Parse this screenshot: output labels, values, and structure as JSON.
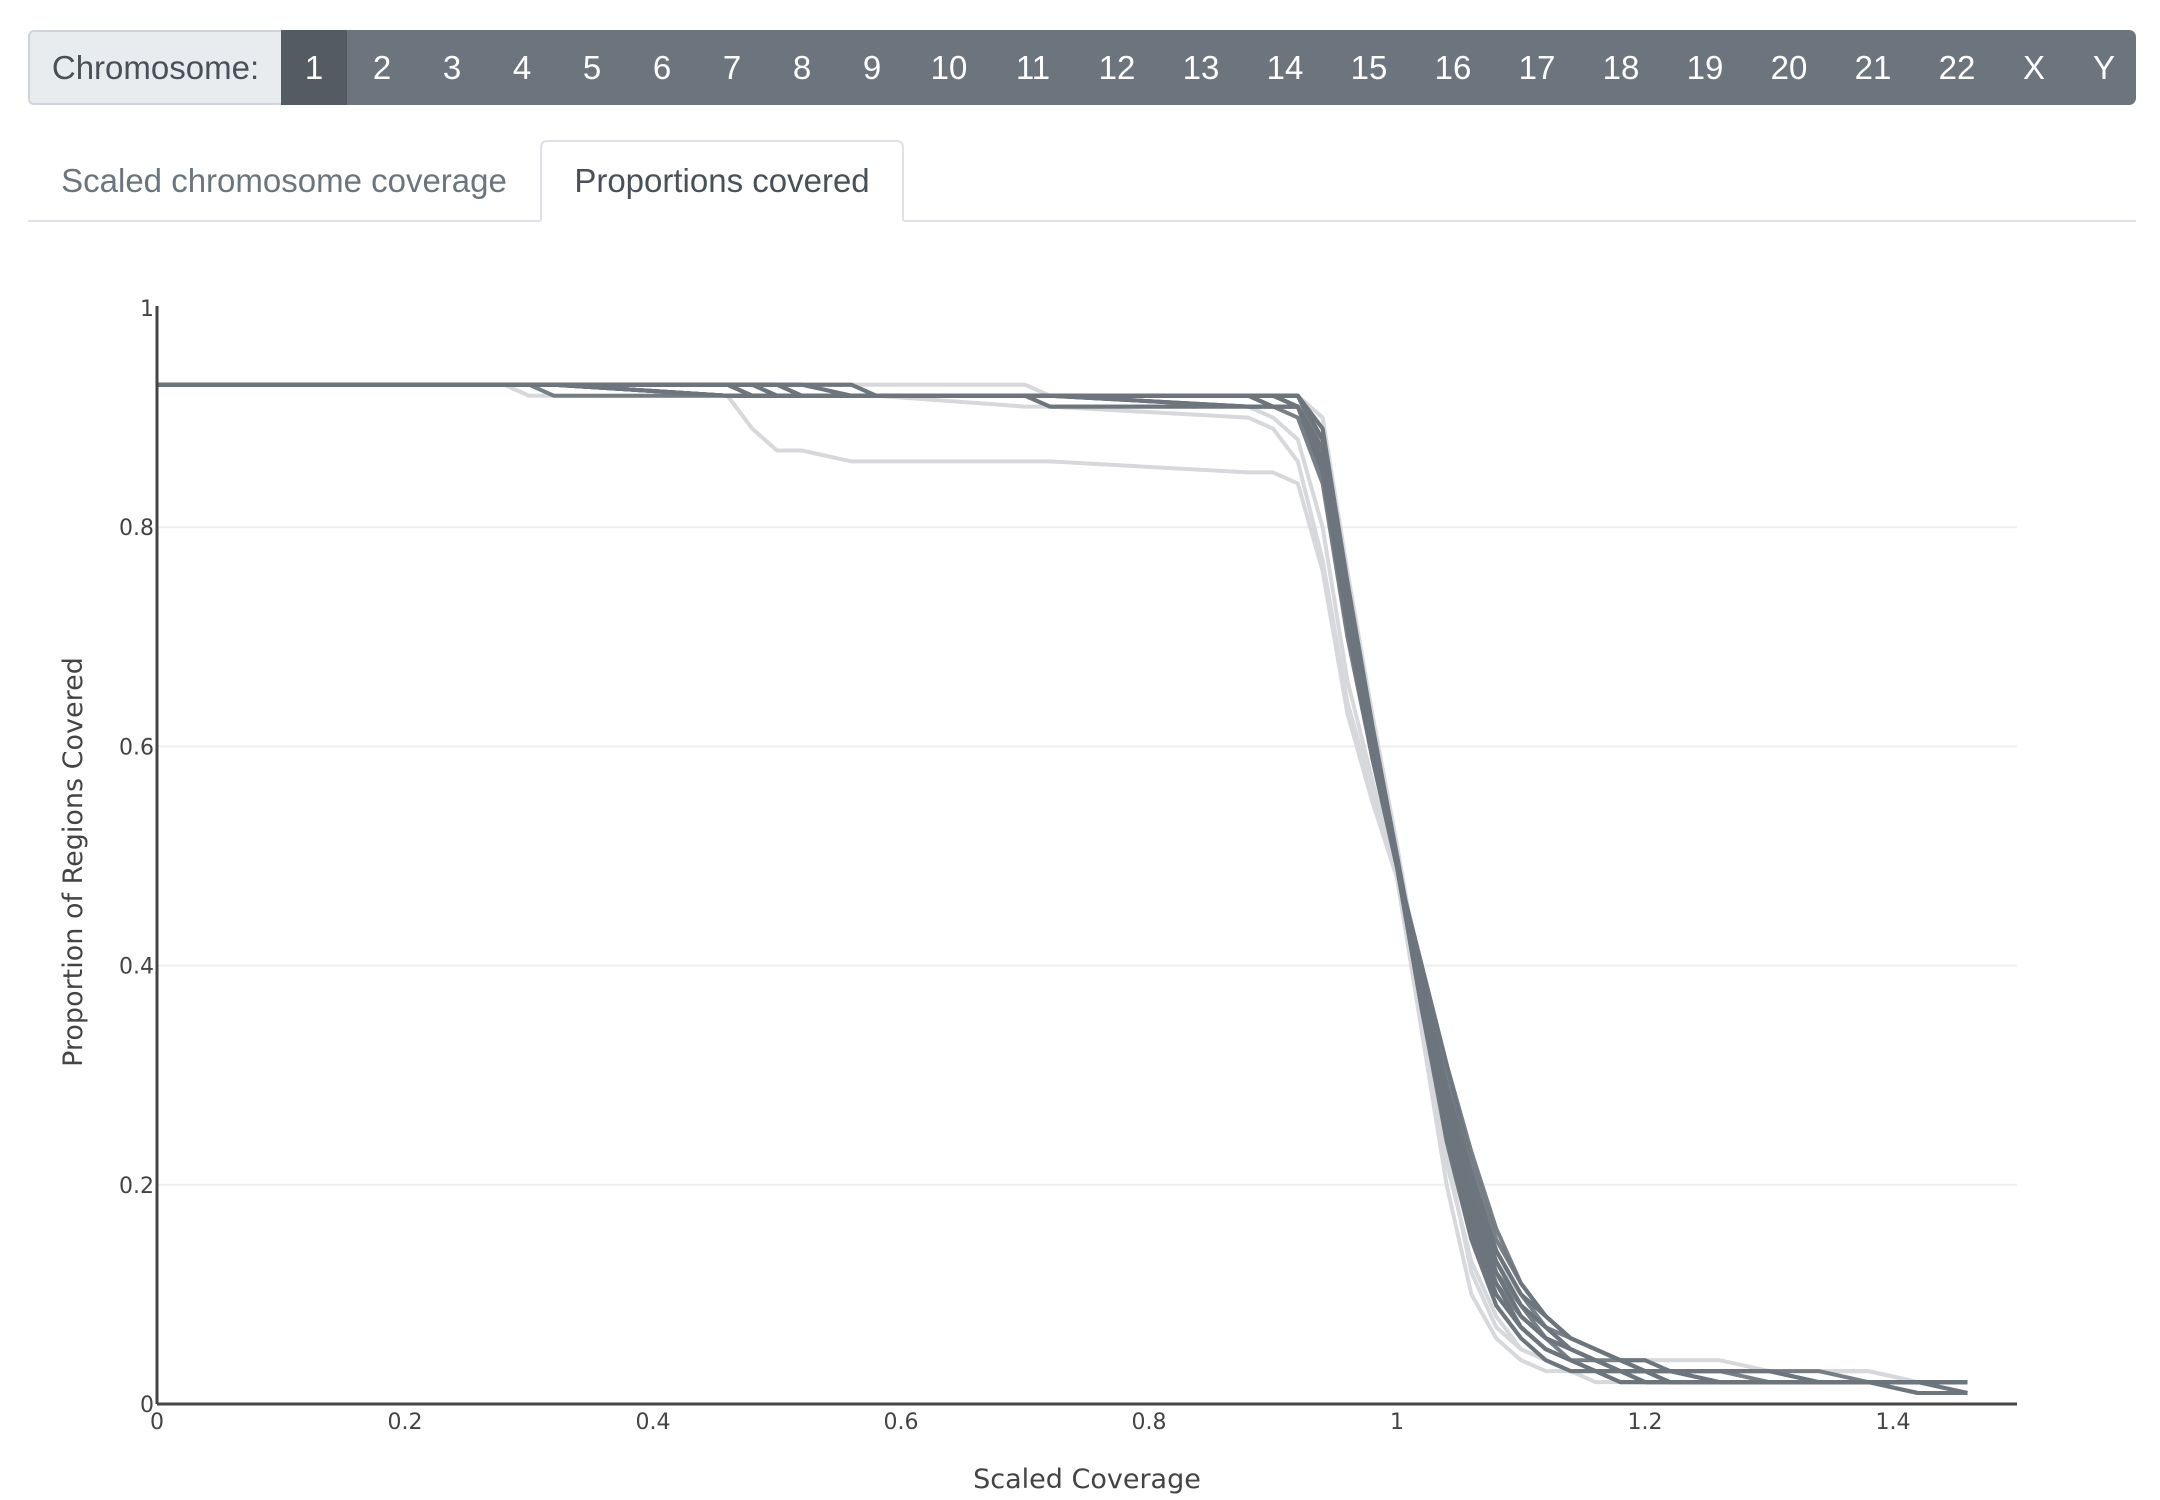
{
  "selector": {
    "label": "Chromosome:",
    "chromosomes": [
      "1",
      "2",
      "3",
      "4",
      "5",
      "6",
      "7",
      "8",
      "9",
      "10",
      "11",
      "12",
      "13",
      "14",
      "15",
      "16",
      "17",
      "18",
      "19",
      "20",
      "21",
      "22",
      "X",
      "Y"
    ],
    "active": "1",
    "bar_color": "#6c757d",
    "active_color": "#545b62"
  },
  "tabs": [
    {
      "label": "Scaled chromosome coverage",
      "active": false
    },
    {
      "label": "Proportions covered",
      "active": true
    }
  ],
  "chart_data": {
    "type": "line",
    "title": "",
    "xlabel": "Scaled Coverage",
    "ylabel": "Proportion of Regions Covered",
    "xlim": [
      0,
      1.5
    ],
    "ylim": [
      0,
      1
    ],
    "xticks": [
      0,
      0.2,
      0.4,
      0.6,
      0.8,
      1,
      1.2,
      1.4
    ],
    "xtick_labels": [
      "0",
      "0.2",
      "0.4",
      "0.6",
      "0.8",
      "1",
      "1.2",
      "1.4"
    ],
    "yticks": [
      0,
      0.2,
      0.4,
      0.6,
      0.8,
      1
    ],
    "ytick_labels": [
      "0",
      "0.2",
      "0.4",
      "0.6",
      "0.8",
      "1"
    ],
    "grid": "horizontal",
    "legend": "none",
    "line_color": "#6c757d",
    "faint_line_color": "#d6d8db",
    "x": [
      0,
      0.28,
      0.3,
      0.32,
      0.46,
      0.48,
      0.5,
      0.52,
      0.56,
      0.58,
      0.7,
      0.72,
      0.88,
      0.9,
      0.92,
      0.94,
      0.96,
      0.98,
      1.0,
      1.02,
      1.04,
      1.06,
      1.08,
      1.1,
      1.12,
      1.14,
      1.16,
      1.18,
      1.2,
      1.22,
      1.26,
      1.3,
      1.34,
      1.38,
      1.42,
      1.46
    ],
    "series": [
      {
        "name": "series-1",
        "opacity": 1.0,
        "values": [
          0.93,
          0.93,
          0.93,
          0.93,
          0.93,
          0.93,
          0.93,
          0.93,
          0.92,
          0.92,
          0.92,
          0.92,
          0.92,
          0.92,
          0.92,
          0.88,
          0.74,
          0.61,
          0.49,
          0.36,
          0.25,
          0.17,
          0.11,
          0.08,
          0.06,
          0.05,
          0.04,
          0.03,
          0.03,
          0.02,
          0.02,
          0.02,
          0.02,
          0.02,
          0.02,
          0.02
        ]
      },
      {
        "name": "series-2",
        "opacity": 1.0,
        "values": [
          0.93,
          0.93,
          0.93,
          0.93,
          0.93,
          0.92,
          0.92,
          0.92,
          0.92,
          0.92,
          0.92,
          0.92,
          0.92,
          0.92,
          0.91,
          0.86,
          0.72,
          0.6,
          0.49,
          0.37,
          0.26,
          0.17,
          0.11,
          0.07,
          0.05,
          0.04,
          0.03,
          0.03,
          0.02,
          0.02,
          0.02,
          0.02,
          0.02,
          0.02,
          0.01,
          0.01
        ]
      },
      {
        "name": "series-3",
        "opacity": 1.0,
        "values": [
          0.93,
          0.93,
          0.93,
          0.93,
          0.92,
          0.92,
          0.92,
          0.92,
          0.92,
          0.92,
          0.92,
          0.91,
          0.91,
          0.91,
          0.91,
          0.87,
          0.73,
          0.61,
          0.5,
          0.38,
          0.28,
          0.19,
          0.13,
          0.09,
          0.07,
          0.05,
          0.04,
          0.03,
          0.03,
          0.03,
          0.02,
          0.02,
          0.02,
          0.02,
          0.02,
          0.02
        ]
      },
      {
        "name": "series-4",
        "opacity": 1.0,
        "values": [
          0.93,
          0.93,
          0.93,
          0.92,
          0.92,
          0.92,
          0.92,
          0.92,
          0.92,
          0.92,
          0.92,
          0.92,
          0.91,
          0.91,
          0.91,
          0.85,
          0.71,
          0.59,
          0.49,
          0.39,
          0.29,
          0.21,
          0.14,
          0.1,
          0.08,
          0.06,
          0.05,
          0.04,
          0.03,
          0.03,
          0.03,
          0.03,
          0.02,
          0.02,
          0.02,
          0.02
        ]
      },
      {
        "name": "series-5",
        "opacity": 1.0,
        "values": [
          0.93,
          0.93,
          0.93,
          0.93,
          0.93,
          0.93,
          0.93,
          0.92,
          0.92,
          0.92,
          0.92,
          0.92,
          0.92,
          0.92,
          0.92,
          0.89,
          0.75,
          0.62,
          0.5,
          0.37,
          0.24,
          0.15,
          0.09,
          0.06,
          0.04,
          0.03,
          0.03,
          0.02,
          0.02,
          0.02,
          0.02,
          0.02,
          0.02,
          0.02,
          0.02,
          0.02
        ]
      },
      {
        "name": "series-6",
        "opacity": 1.0,
        "values": [
          0.93,
          0.93,
          0.93,
          0.93,
          0.92,
          0.92,
          0.92,
          0.92,
          0.92,
          0.92,
          0.92,
          0.92,
          0.92,
          0.91,
          0.9,
          0.84,
          0.7,
          0.59,
          0.49,
          0.4,
          0.31,
          0.22,
          0.15,
          0.11,
          0.08,
          0.06,
          0.05,
          0.04,
          0.04,
          0.03,
          0.03,
          0.03,
          0.02,
          0.02,
          0.02,
          0.02
        ]
      },
      {
        "name": "series-7",
        "opacity": 1.0,
        "values": [
          0.93,
          0.93,
          0.93,
          0.93,
          0.93,
          0.92,
          0.92,
          0.92,
          0.92,
          0.92,
          0.92,
          0.92,
          0.92,
          0.92,
          0.91,
          0.87,
          0.73,
          0.6,
          0.49,
          0.37,
          0.27,
          0.18,
          0.12,
          0.08,
          0.06,
          0.05,
          0.04,
          0.03,
          0.03,
          0.02,
          0.02,
          0.02,
          0.02,
          0.02,
          0.02,
          0.01
        ]
      },
      {
        "name": "series-8",
        "opacity": 1.0,
        "values": [
          0.93,
          0.93,
          0.93,
          0.93,
          0.93,
          0.93,
          0.92,
          0.92,
          0.92,
          0.92,
          0.92,
          0.92,
          0.91,
          0.91,
          0.91,
          0.86,
          0.72,
          0.6,
          0.5,
          0.38,
          0.27,
          0.19,
          0.12,
          0.09,
          0.06,
          0.05,
          0.04,
          0.03,
          0.03,
          0.02,
          0.02,
          0.02,
          0.02,
          0.02,
          0.02,
          0.02
        ]
      },
      {
        "name": "series-9",
        "opacity": 1.0,
        "values": [
          0.93,
          0.93,
          0.93,
          0.93,
          0.93,
          0.93,
          0.93,
          0.93,
          0.93,
          0.92,
          0.92,
          0.92,
          0.92,
          0.92,
          0.92,
          0.88,
          0.74,
          0.61,
          0.49,
          0.36,
          0.25,
          0.16,
          0.1,
          0.07,
          0.05,
          0.04,
          0.03,
          0.03,
          0.02,
          0.02,
          0.02,
          0.02,
          0.02,
          0.02,
          0.02,
          0.02
        ]
      },
      {
        "name": "series-10",
        "opacity": 1.0,
        "values": [
          0.93,
          0.93,
          0.93,
          0.93,
          0.92,
          0.92,
          0.92,
          0.92,
          0.92,
          0.92,
          0.92,
          0.92,
          0.92,
          0.91,
          0.91,
          0.86,
          0.72,
          0.6,
          0.49,
          0.38,
          0.28,
          0.2,
          0.13,
          0.09,
          0.07,
          0.05,
          0.04,
          0.04,
          0.03,
          0.03,
          0.03,
          0.02,
          0.02,
          0.02,
          0.02,
          0.02
        ]
      },
      {
        "name": "series-11",
        "opacity": 1.0,
        "values": [
          0.93,
          0.93,
          0.93,
          0.93,
          0.93,
          0.93,
          0.92,
          0.92,
          0.92,
          0.92,
          0.92,
          0.92,
          0.92,
          0.92,
          0.91,
          0.87,
          0.73,
          0.61,
          0.5,
          0.37,
          0.26,
          0.17,
          0.11,
          0.07,
          0.05,
          0.04,
          0.03,
          0.03,
          0.02,
          0.02,
          0.02,
          0.02,
          0.02,
          0.02,
          0.02,
          0.02
        ]
      },
      {
        "name": "series-12",
        "opacity": 1.0,
        "values": [
          0.93,
          0.93,
          0.93,
          0.93,
          0.93,
          0.92,
          0.92,
          0.92,
          0.92,
          0.92,
          0.92,
          0.91,
          0.91,
          0.91,
          0.91,
          0.85,
          0.71,
          0.59,
          0.49,
          0.39,
          0.3,
          0.21,
          0.14,
          0.1,
          0.07,
          0.06,
          0.05,
          0.04,
          0.03,
          0.03,
          0.02,
          0.02,
          0.02,
          0.02,
          0.02,
          0.02
        ]
      },
      {
        "name": "series-13",
        "opacity": 1.0,
        "values": [
          0.93,
          0.93,
          0.93,
          0.93,
          0.93,
          0.93,
          0.93,
          0.93,
          0.92,
          0.92,
          0.92,
          0.92,
          0.92,
          0.92,
          0.92,
          0.88,
          0.74,
          0.61,
          0.49,
          0.36,
          0.25,
          0.16,
          0.1,
          0.07,
          0.05,
          0.04,
          0.03,
          0.03,
          0.03,
          0.02,
          0.02,
          0.02,
          0.02,
          0.02,
          0.02,
          0.02
        ]
      },
      {
        "name": "series-14",
        "opacity": 1.0,
        "values": [
          0.93,
          0.93,
          0.93,
          0.93,
          0.92,
          0.92,
          0.92,
          0.92,
          0.92,
          0.92,
          0.92,
          0.92,
          0.92,
          0.92,
          0.91,
          0.86,
          0.72,
          0.6,
          0.49,
          0.38,
          0.28,
          0.19,
          0.13,
          0.09,
          0.07,
          0.05,
          0.04,
          0.03,
          0.03,
          0.03,
          0.02,
          0.02,
          0.02,
          0.02,
          0.02,
          0.02
        ]
      },
      {
        "name": "series-15",
        "opacity": 1.0,
        "values": [
          0.93,
          0.93,
          0.93,
          0.93,
          0.93,
          0.93,
          0.93,
          0.92,
          0.92,
          0.92,
          0.92,
          0.92,
          0.92,
          0.92,
          0.92,
          0.87,
          0.73,
          0.61,
          0.5,
          0.37,
          0.26,
          0.18,
          0.12,
          0.08,
          0.06,
          0.04,
          0.04,
          0.03,
          0.02,
          0.02,
          0.02,
          0.02,
          0.02,
          0.02,
          0.02,
          0.02
        ]
      },
      {
        "name": "series-16",
        "opacity": 1.0,
        "values": [
          0.93,
          0.93,
          0.93,
          0.93,
          0.93,
          0.92,
          0.92,
          0.92,
          0.92,
          0.92,
          0.92,
          0.92,
          0.91,
          0.91,
          0.91,
          0.86,
          0.71,
          0.6,
          0.49,
          0.39,
          0.29,
          0.2,
          0.14,
          0.1,
          0.08,
          0.06,
          0.05,
          0.04,
          0.03,
          0.03,
          0.03,
          0.03,
          0.03,
          0.02,
          0.02,
          0.02
        ]
      },
      {
        "name": "series-17",
        "opacity": 1.0,
        "values": [
          0.93,
          0.93,
          0.93,
          0.93,
          0.93,
          0.93,
          0.93,
          0.93,
          0.93,
          0.92,
          0.92,
          0.92,
          0.92,
          0.92,
          0.92,
          0.89,
          0.75,
          0.62,
          0.5,
          0.36,
          0.24,
          0.15,
          0.09,
          0.06,
          0.04,
          0.03,
          0.03,
          0.02,
          0.02,
          0.02,
          0.02,
          0.02,
          0.02,
          0.02,
          0.02,
          0.02
        ]
      },
      {
        "name": "series-18",
        "opacity": 1.0,
        "values": [
          0.93,
          0.93,
          0.93,
          0.93,
          0.93,
          0.93,
          0.92,
          0.92,
          0.92,
          0.92,
          0.92,
          0.92,
          0.92,
          0.92,
          0.91,
          0.87,
          0.72,
          0.6,
          0.49,
          0.37,
          0.27,
          0.18,
          0.12,
          0.08,
          0.06,
          0.05,
          0.04,
          0.03,
          0.03,
          0.02,
          0.02,
          0.02,
          0.02,
          0.02,
          0.02,
          0.01
        ]
      },
      {
        "name": "series-19",
        "opacity": 1.0,
        "values": [
          0.93,
          0.93,
          0.93,
          0.93,
          0.93,
          0.93,
          0.93,
          0.92,
          0.92,
          0.92,
          0.92,
          0.92,
          0.92,
          0.92,
          0.92,
          0.88,
          0.74,
          0.61,
          0.5,
          0.37,
          0.25,
          0.16,
          0.1,
          0.07,
          0.05,
          0.04,
          0.03,
          0.02,
          0.02,
          0.02,
          0.02,
          0.02,
          0.02,
          0.02,
          0.01,
          0.01
        ]
      },
      {
        "name": "series-20",
        "opacity": 1.0,
        "values": [
          0.93,
          0.93,
          0.93,
          0.93,
          0.92,
          0.92,
          0.92,
          0.92,
          0.92,
          0.92,
          0.92,
          0.92,
          0.92,
          0.91,
          0.91,
          0.85,
          0.71,
          0.59,
          0.49,
          0.4,
          0.31,
          0.23,
          0.16,
          0.11,
          0.08,
          0.06,
          0.05,
          0.04,
          0.04,
          0.03,
          0.03,
          0.03,
          0.02,
          0.02,
          0.02,
          0.02
        ]
      },
      {
        "name": "series-21",
        "opacity": 0.45,
        "values": [
          0.93,
          0.93,
          0.92,
          0.92,
          0.92,
          0.92,
          0.92,
          0.92,
          0.92,
          0.92,
          0.92,
          0.91,
          0.91,
          0.9,
          0.88,
          0.8,
          0.66,
          0.57,
          0.48,
          0.36,
          0.23,
          0.12,
          0.07,
          0.05,
          0.04,
          0.03,
          0.03,
          0.03,
          0.03,
          0.03,
          0.03,
          0.03,
          0.03,
          0.03,
          0.02,
          0.02
        ]
      },
      {
        "name": "series-22",
        "opacity": 0.45,
        "values": [
          0.93,
          0.93,
          0.93,
          0.93,
          0.93,
          0.93,
          0.93,
          0.93,
          0.93,
          0.93,
          0.93,
          0.92,
          0.92,
          0.92,
          0.92,
          0.9,
          0.76,
          0.63,
          0.51,
          0.38,
          0.27,
          0.19,
          0.13,
          0.1,
          0.08,
          0.06,
          0.05,
          0.04,
          0.04,
          0.04,
          0.04,
          0.03,
          0.03,
          0.03,
          0.02,
          0.02
        ]
      },
      {
        "name": "series-23",
        "opacity": 0.3,
        "values": [
          0.93,
          0.93,
          0.93,
          0.93,
          0.92,
          0.92,
          0.92,
          0.92,
          0.92,
          0.92,
          0.91,
          0.91,
          0.9,
          0.89,
          0.86,
          0.77,
          0.64,
          0.56,
          0.48,
          0.34,
          0.2,
          0.1,
          0.06,
          0.04,
          0.03,
          0.03,
          0.02,
          0.02,
          0.02,
          0.02,
          0.02,
          0.02,
          0.02,
          0.02,
          0.01,
          0.01
        ]
      },
      {
        "name": "series-24",
        "opacity": 0.3,
        "values": [
          0.93,
          0.93,
          0.93,
          0.93,
          0.92,
          0.89,
          0.87,
          0.87,
          0.86,
          0.86,
          0.86,
          0.86,
          0.85,
          0.85,
          0.84,
          0.76,
          0.63,
          0.55,
          0.48,
          0.35,
          0.22,
          0.13,
          0.08,
          0.05,
          0.04,
          0.03,
          0.03,
          0.03,
          0.03,
          0.03,
          0.03,
          0.03,
          0.03,
          0.03,
          0.02,
          0.02
        ]
      }
    ]
  }
}
